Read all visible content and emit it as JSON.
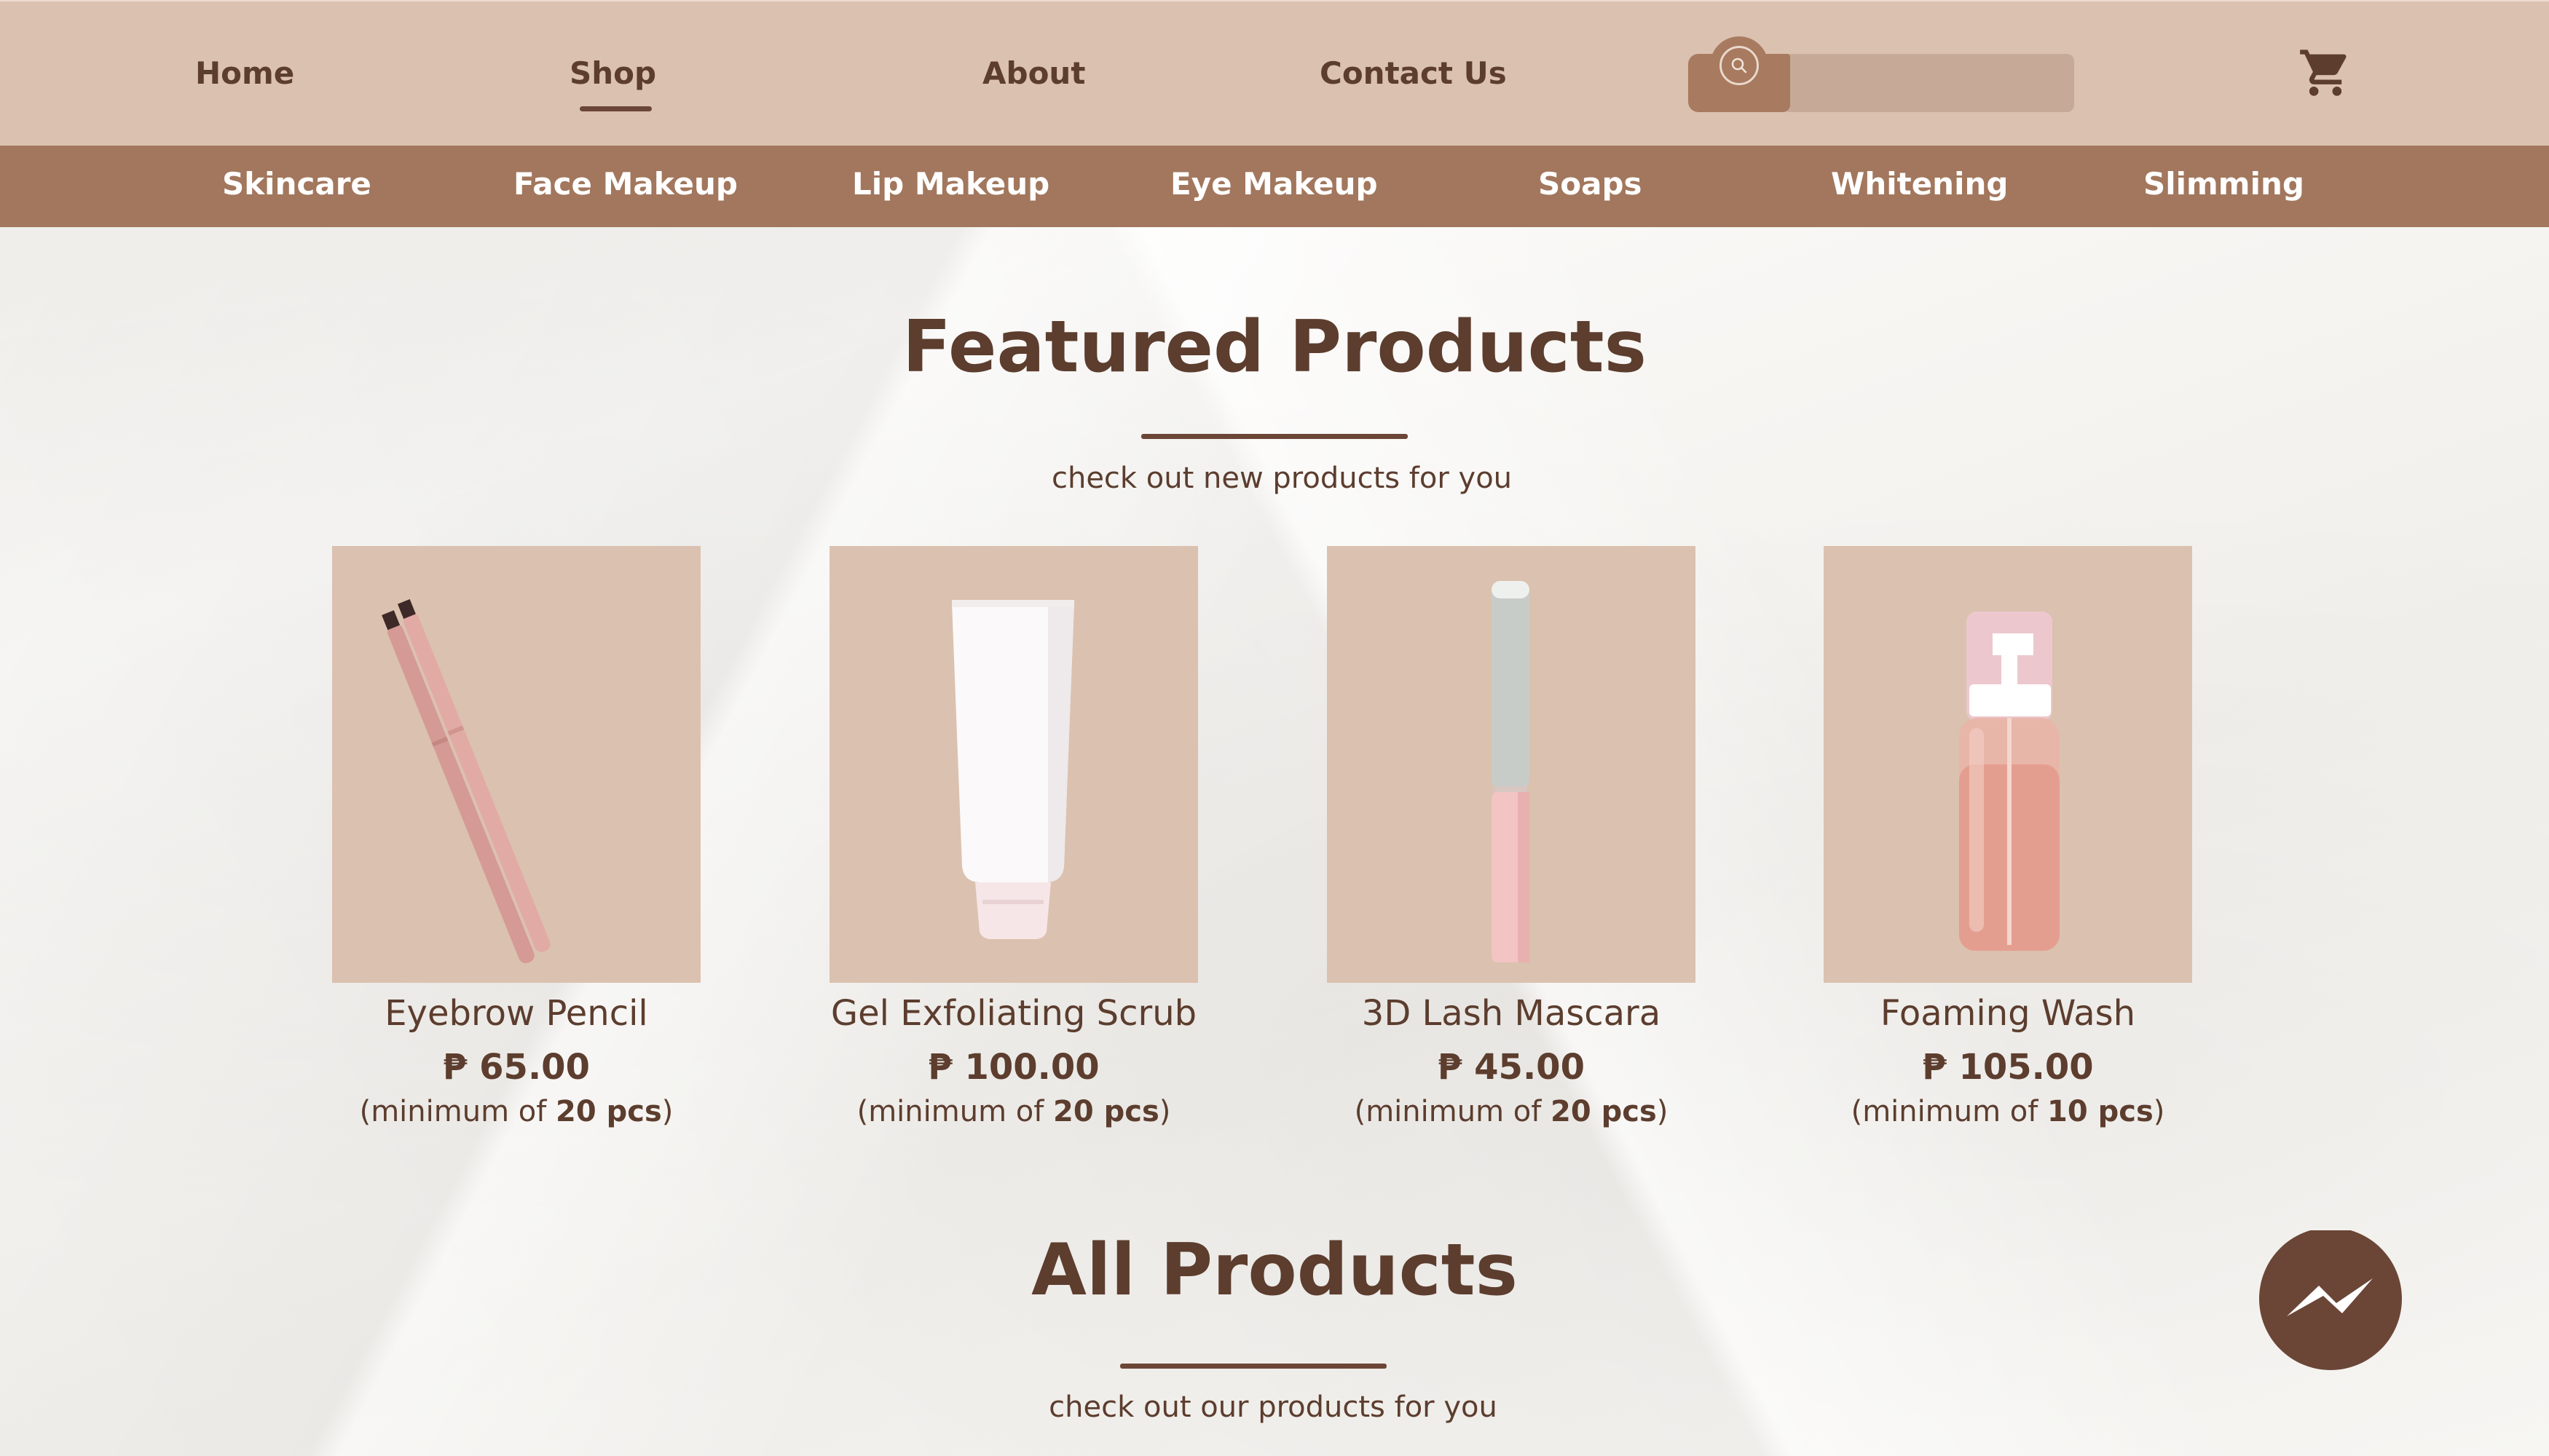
{
  "nav": {
    "items": [
      "Home",
      "Shop",
      "About",
      "Contact Us"
    ],
    "active": "Shop"
  },
  "search": {
    "icon": "search-icon",
    "placeholder": ""
  },
  "cart": {
    "icon": "cart-icon"
  },
  "categories": [
    "Skincare",
    "Face Makeup",
    "Lip Makeup",
    "Eye Makeup",
    "Soaps",
    "Whitening",
    "Slimming"
  ],
  "featured": {
    "title": "Featured Products",
    "subtitle": "check out new products for you",
    "products": [
      {
        "name": "Eyebrow Pencil",
        "price": "₱ 65.00",
        "min_prefix": "(minimum of ",
        "min_qty": "20 pcs",
        "min_suffix": ")"
      },
      {
        "name": "Gel Exfoliating Scrub",
        "price": "₱ 100.00",
        "min_prefix": "(minimum of ",
        "min_qty": "20 pcs",
        "min_suffix": ")"
      },
      {
        "name": "3D Lash Mascara",
        "price": "₱ 45.00",
        "min_prefix": "(minimum of ",
        "min_qty": "20 pcs",
        "min_suffix": ")"
      },
      {
        "name": "Foaming Wash",
        "price": "₱ 105.00",
        "min_prefix": "(minimum of ",
        "min_qty": "10 pcs",
        "min_suffix": ")"
      }
    ]
  },
  "all_products": {
    "title": "All Products",
    "subtitle": "check out our products for you"
  },
  "messenger": {
    "icon": "messenger-icon"
  },
  "colors": {
    "nav_bg": "#dbc1af",
    "category_bg": "#a2775d",
    "text_brown": "#5c3d2e",
    "card_bg": "#dbc1af",
    "page_bg": "#f6f4f0"
  }
}
